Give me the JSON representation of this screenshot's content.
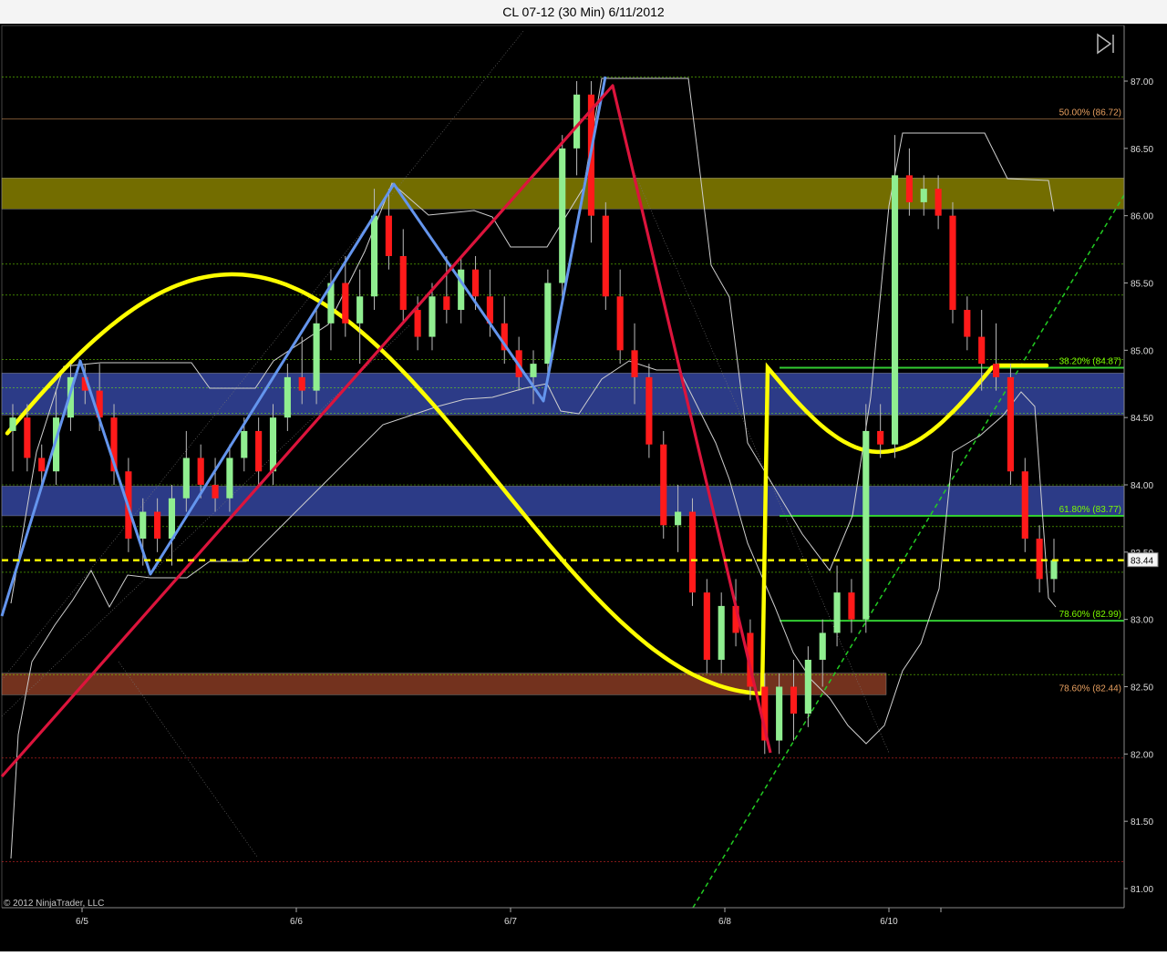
{
  "window": {
    "title": "CL 07-12 (30 Min)  6/11/2012"
  },
  "copyright": "© 2012 NinjaTrader, LLC",
  "controls": {
    "scroll_to_end_icon": "skip-to-end-icon"
  },
  "colors": {
    "background": "#000000",
    "bull_candle": "#90ee90",
    "bear_candle": "#ff1a1a",
    "yellow_zone": "#7a7300",
    "blue_zone": "#2f3f8f",
    "brown_zone": "#7a3520",
    "cycle_line": "#ffff00",
    "blue_zigzag": "#6495ed",
    "red_zigzag": "#dc143c",
    "current_price": "#ffff00"
  },
  "chart_data": {
    "type": "candlestick",
    "instrument": "CL 07-12",
    "interval": "30 Min",
    "ylim": [
      80.8,
      87.6
    ],
    "y_ticks": [
      "87.00",
      "86.50",
      "86.00",
      "85.50",
      "85.00",
      "84.50",
      "84.00",
      "83.50",
      "83.00",
      "82.50",
      "82.00",
      "81.50",
      "81.00"
    ],
    "x_ticks": [
      "6/5",
      "6/6",
      "6/7",
      "6/8",
      "6/10"
    ],
    "current_price": 83.44,
    "current_price_label": "83.44",
    "price_axis_label_partial": "83.50",
    "fib_levels": [
      {
        "label": "50.00% (86.72)",
        "price": 86.72,
        "color": "#e8a060"
      },
      {
        "label": "38.20% (84.87)",
        "price": 84.87,
        "color": "#7cfc00"
      },
      {
        "label": "61.80% (83.77)",
        "price": 83.77,
        "color": "#7cfc00"
      },
      {
        "label": "78.60% (82.99)",
        "price": 82.99,
        "color": "#7cfc00"
      },
      {
        "label": "78.60% (82.44)",
        "price": 82.44,
        "color": "#e8a060"
      }
    ],
    "zones": [
      {
        "name": "yellow",
        "from": 86.05,
        "to": 86.28
      },
      {
        "name": "blue-upper",
        "from": 84.52,
        "to": 84.83
      },
      {
        "name": "blue-lower",
        "from": 83.77,
        "to": 83.99
      },
      {
        "name": "brown",
        "from": 82.44,
        "to": 82.6
      }
    ],
    "reference_lines": [
      87.03,
      86.72,
      85.64,
      85.41,
      84.93,
      84.72,
      84.53,
      84.0,
      83.69,
      83.35,
      82.59,
      81.97,
      81.2
    ],
    "candles": [
      {
        "o": 84.4,
        "h": 84.6,
        "l": 84.1,
        "c": 84.5
      },
      {
        "o": 84.5,
        "h": 84.6,
        "l": 84.1,
        "c": 84.2
      },
      {
        "o": 84.2,
        "h": 84.3,
        "l": 84.0,
        "c": 84.1
      },
      {
        "o": 84.1,
        "h": 84.7,
        "l": 84.0,
        "c": 84.5
      },
      {
        "o": 84.5,
        "h": 84.9,
        "l": 84.4,
        "c": 84.8
      },
      {
        "o": 84.8,
        "h": 84.9,
        "l": 84.6,
        "c": 84.7
      },
      {
        "o": 84.7,
        "h": 84.9,
        "l": 84.4,
        "c": 84.5
      },
      {
        "o": 84.5,
        "h": 84.6,
        "l": 84.0,
        "c": 84.1
      },
      {
        "o": 84.1,
        "h": 84.2,
        "l": 83.5,
        "c": 83.6
      },
      {
        "o": 83.6,
        "h": 83.9,
        "l": 83.4,
        "c": 83.8
      },
      {
        "o": 83.8,
        "h": 83.9,
        "l": 83.5,
        "c": 83.6
      },
      {
        "o": 83.6,
        "h": 84.0,
        "l": 83.4,
        "c": 83.9
      },
      {
        "o": 83.9,
        "h": 84.4,
        "l": 83.8,
        "c": 84.2
      },
      {
        "o": 84.2,
        "h": 84.3,
        "l": 83.9,
        "c": 84.0
      },
      {
        "o": 84.0,
        "h": 84.2,
        "l": 83.8,
        "c": 83.9
      },
      {
        "o": 83.9,
        "h": 84.3,
        "l": 83.8,
        "c": 84.2
      },
      {
        "o": 84.2,
        "h": 84.5,
        "l": 84.1,
        "c": 84.4
      },
      {
        "o": 84.4,
        "h": 84.5,
        "l": 84.0,
        "c": 84.1
      },
      {
        "o": 84.1,
        "h": 84.6,
        "l": 84.0,
        "c": 84.5
      },
      {
        "o": 84.5,
        "h": 84.9,
        "l": 84.4,
        "c": 84.8
      },
      {
        "o": 84.8,
        "h": 85.1,
        "l": 84.6,
        "c": 84.7
      },
      {
        "o": 84.7,
        "h": 85.3,
        "l": 84.6,
        "c": 85.2
      },
      {
        "o": 85.2,
        "h": 85.6,
        "l": 85.0,
        "c": 85.5
      },
      {
        "o": 85.5,
        "h": 85.7,
        "l": 85.1,
        "c": 85.2
      },
      {
        "o": 85.2,
        "h": 85.6,
        "l": 84.9,
        "c": 85.4
      },
      {
        "o": 85.4,
        "h": 86.2,
        "l": 85.3,
        "c": 86.0
      },
      {
        "o": 86.0,
        "h": 86.2,
        "l": 85.6,
        "c": 85.7
      },
      {
        "o": 85.7,
        "h": 85.9,
        "l": 85.2,
        "c": 85.3
      },
      {
        "o": 85.3,
        "h": 85.4,
        "l": 85.0,
        "c": 85.1
      },
      {
        "o": 85.1,
        "h": 85.5,
        "l": 85.0,
        "c": 85.4
      },
      {
        "o": 85.4,
        "h": 85.7,
        "l": 85.2,
        "c": 85.3
      },
      {
        "o": 85.3,
        "h": 85.7,
        "l": 85.2,
        "c": 85.6
      },
      {
        "o": 85.6,
        "h": 85.7,
        "l": 85.3,
        "c": 85.4
      },
      {
        "o": 85.4,
        "h": 85.6,
        "l": 85.1,
        "c": 85.2
      },
      {
        "o": 85.2,
        "h": 85.4,
        "l": 84.9,
        "c": 85.0
      },
      {
        "o": 85.0,
        "h": 85.1,
        "l": 84.7,
        "c": 84.8
      },
      {
        "o": 84.8,
        "h": 85.0,
        "l": 84.6,
        "c": 84.9
      },
      {
        "o": 84.9,
        "h": 85.6,
        "l": 84.8,
        "c": 85.5
      },
      {
        "o": 85.5,
        "h": 86.6,
        "l": 85.4,
        "c": 86.5
      },
      {
        "o": 86.5,
        "h": 87.0,
        "l": 86.3,
        "c": 86.9
      },
      {
        "o": 86.9,
        "h": 87.0,
        "l": 85.8,
        "c": 86.0
      },
      {
        "o": 86.0,
        "h": 86.1,
        "l": 85.3,
        "c": 85.4
      },
      {
        "o": 85.4,
        "h": 85.6,
        "l": 84.9,
        "c": 85.0
      },
      {
        "o": 85.0,
        "h": 85.2,
        "l": 84.6,
        "c": 84.8
      },
      {
        "o": 84.8,
        "h": 84.9,
        "l": 84.2,
        "c": 84.3
      },
      {
        "o": 84.3,
        "h": 84.4,
        "l": 83.6,
        "c": 83.7
      },
      {
        "o": 83.7,
        "h": 84.0,
        "l": 83.5,
        "c": 83.8
      },
      {
        "o": 83.8,
        "h": 83.9,
        "l": 83.1,
        "c": 83.2
      },
      {
        "o": 83.2,
        "h": 83.3,
        "l": 82.6,
        "c": 82.7
      },
      {
        "o": 82.7,
        "h": 83.2,
        "l": 82.6,
        "c": 83.1
      },
      {
        "o": 83.1,
        "h": 83.3,
        "l": 82.8,
        "c": 82.9
      },
      {
        "o": 82.9,
        "h": 83.0,
        "l": 82.4,
        "c": 82.5
      },
      {
        "o": 82.5,
        "h": 82.6,
        "l": 82.0,
        "c": 82.1
      },
      {
        "o": 82.1,
        "h": 82.6,
        "l": 82.0,
        "c": 82.5
      },
      {
        "o": 82.5,
        "h": 82.7,
        "l": 82.1,
        "c": 82.3
      },
      {
        "o": 82.3,
        "h": 82.8,
        "l": 82.2,
        "c": 82.7
      },
      {
        "o": 82.7,
        "h": 83.0,
        "l": 82.5,
        "c": 82.9
      },
      {
        "o": 82.9,
        "h": 83.4,
        "l": 82.8,
        "c": 83.2
      },
      {
        "o": 83.2,
        "h": 83.3,
        "l": 82.9,
        "c": 83.0
      },
      {
        "o": 83.0,
        "h": 84.6,
        "l": 82.9,
        "c": 84.4
      },
      {
        "o": 84.4,
        "h": 84.6,
        "l": 84.2,
        "c": 84.3
      },
      {
        "o": 84.3,
        "h": 86.6,
        "l": 84.2,
        "c": 86.3
      },
      {
        "o": 86.3,
        "h": 86.5,
        "l": 86.0,
        "c": 86.1
      },
      {
        "o": 86.1,
        "h": 86.3,
        "l": 86.0,
        "c": 86.2
      },
      {
        "o": 86.2,
        "h": 86.3,
        "l": 85.9,
        "c": 86.0
      },
      {
        "o": 86.0,
        "h": 86.1,
        "l": 85.2,
        "c": 85.3
      },
      {
        "o": 85.3,
        "h": 85.4,
        "l": 85.0,
        "c": 85.1
      },
      {
        "o": 85.1,
        "h": 85.3,
        "l": 84.7,
        "c": 84.9
      },
      {
        "o": 84.9,
        "h": 85.2,
        "l": 84.7,
        "c": 84.8
      },
      {
        "o": 84.8,
        "h": 84.9,
        "l": 84.0,
        "c": 84.1
      },
      {
        "o": 84.1,
        "h": 84.2,
        "l": 83.5,
        "c": 83.6
      },
      {
        "o": 83.6,
        "h": 83.7,
        "l": 83.2,
        "c": 83.3
      },
      {
        "o": 83.3,
        "h": 83.6,
        "l": 83.2,
        "c": 83.44
      }
    ]
  }
}
